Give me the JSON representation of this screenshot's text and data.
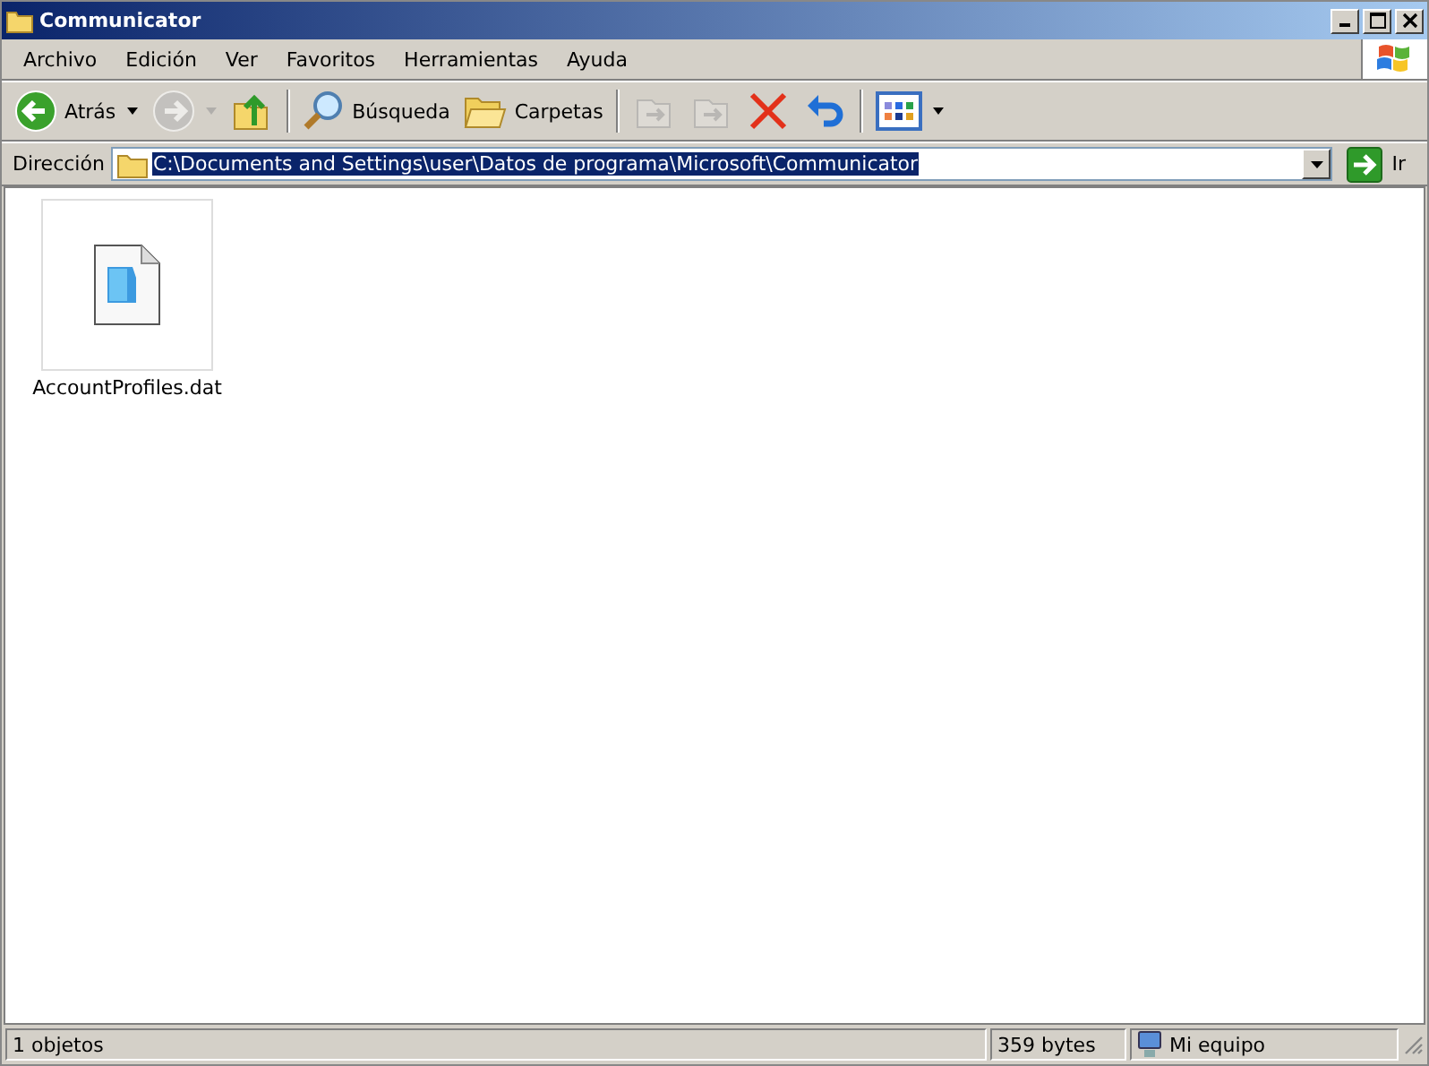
{
  "window": {
    "title": "Communicator"
  },
  "menu": [
    "Archivo",
    "Edición",
    "Ver",
    "Favoritos",
    "Herramientas",
    "Ayuda"
  ],
  "toolbar": [
    {
      "kind": "back",
      "label": "Atrás",
      "disabled": false,
      "dropdown": true
    },
    {
      "kind": "forward",
      "disabled": true,
      "dropdown": true
    },
    {
      "kind": "up",
      "disabled": false,
      "dropdown": false
    },
    {
      "kind": "search",
      "label": "Búsqueda",
      "disabled": false,
      "dropdown": false
    },
    {
      "kind": "folders",
      "label": "Carpetas",
      "disabled": false,
      "dropdown": false
    },
    {
      "kind": "move",
      "disabled": true,
      "dropdown": false
    },
    {
      "kind": "copy",
      "disabled": true,
      "dropdown": false
    },
    {
      "kind": "delete",
      "disabled": false,
      "dropdown": false
    },
    {
      "kind": "undo",
      "disabled": false,
      "dropdown": false
    },
    {
      "kind": "views",
      "disabled": false,
      "dropdown": true
    }
  ],
  "address": {
    "label": "Dirección",
    "value": "C:\\Documents and Settings\\user\\Datos de programa\\Microsoft\\Communicator",
    "text_selected": true,
    "go_label": "Ir"
  },
  "files": [
    {
      "name": "AccountProfiles.dat",
      "selected": false
    }
  ],
  "status_bar": {
    "count": "1 objetos",
    "size": "359 bytes",
    "zone": "Mi equipo"
  }
}
